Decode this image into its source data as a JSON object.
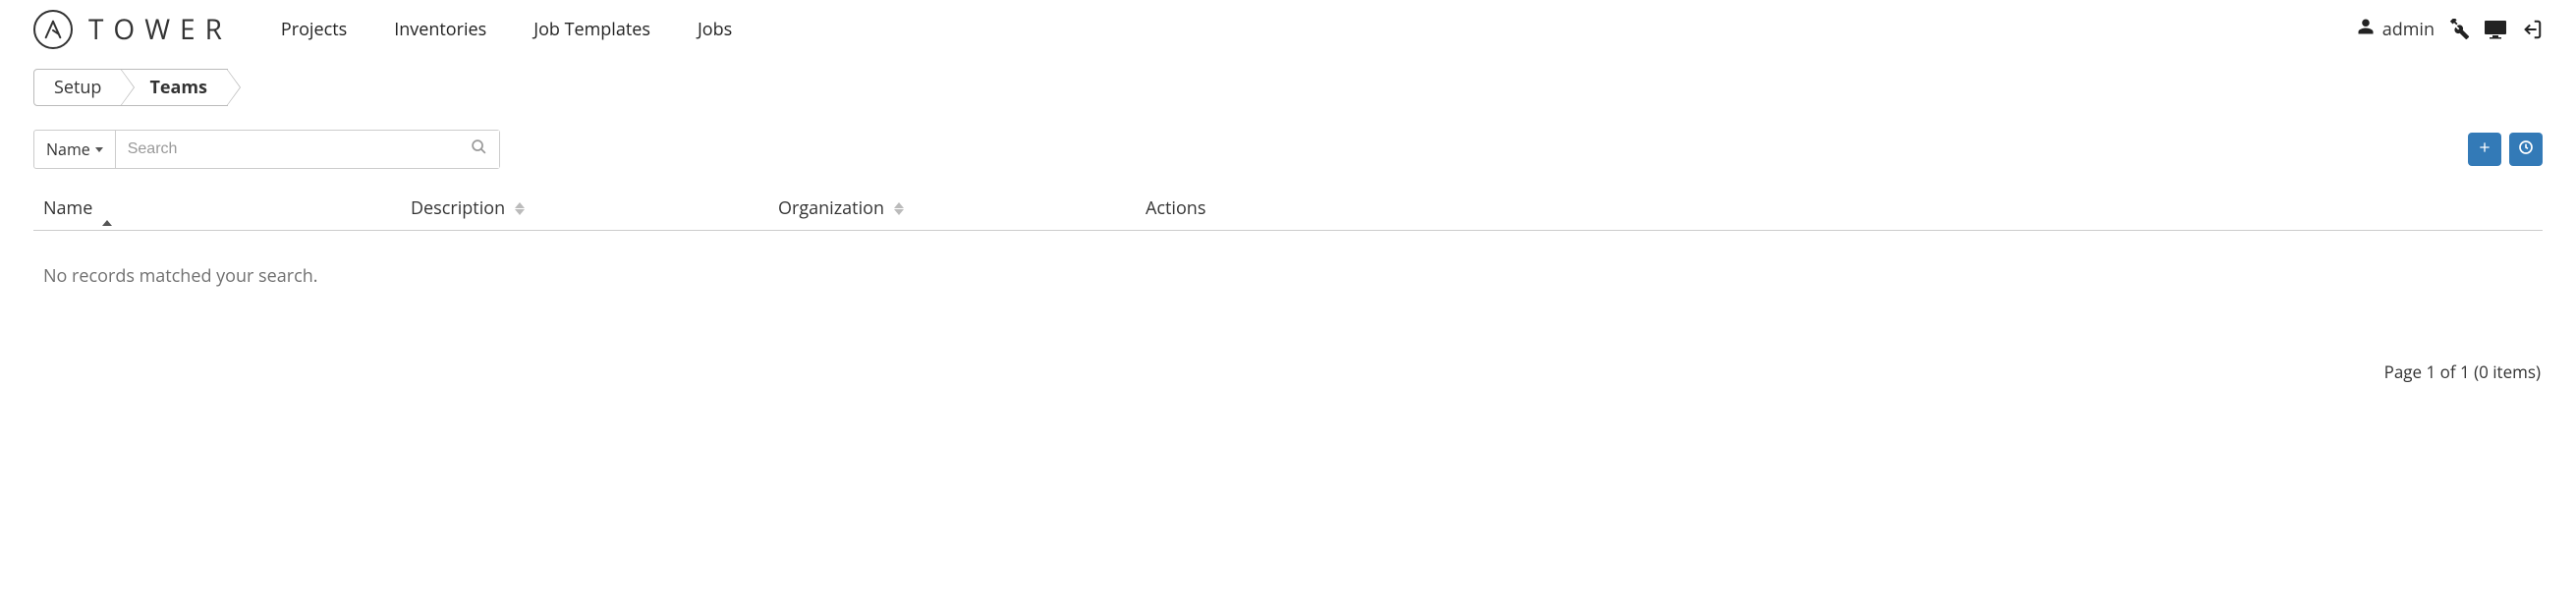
{
  "brand": {
    "name": "TOWER"
  },
  "nav": {
    "projects": "Projects",
    "inventories": "Inventories",
    "job_templates": "Job Templates",
    "jobs": "Jobs"
  },
  "user": {
    "name": "admin"
  },
  "breadcrumb": {
    "setup": "Setup",
    "teams": "Teams"
  },
  "search": {
    "filter_label": "Name",
    "placeholder": "Search"
  },
  "columns": {
    "name": "Name",
    "description": "Description",
    "organization": "Organization",
    "actions": "Actions"
  },
  "empty_message": "No records matched your search.",
  "pagination": "Page 1 of 1 (0 items)"
}
